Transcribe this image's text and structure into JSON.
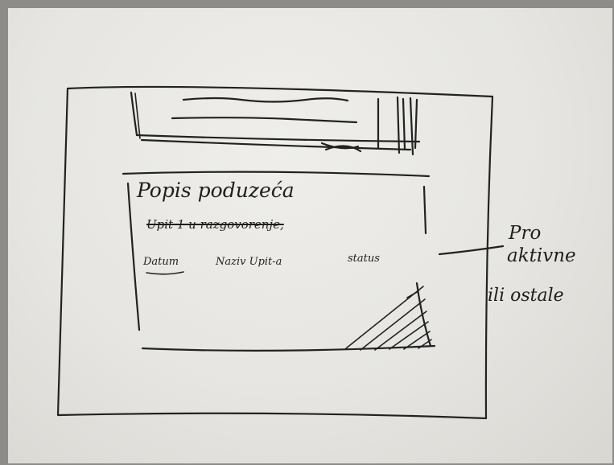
{
  "content": {
    "title": "Popis poduzeća",
    "query_row": "Upit 1 u razgovorenje,",
    "columns": [
      "Datum",
      "Naziv Upit-a",
      "status"
    ]
  },
  "annotation": {
    "lines": [
      "Pro",
      "aktivne",
      "ili ostale"
    ]
  },
  "colors": {
    "ink": "#222222",
    "paper": "#e6e5e1"
  }
}
